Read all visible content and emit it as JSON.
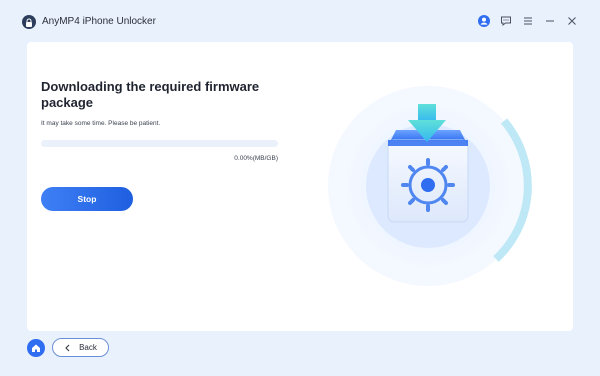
{
  "window": {
    "title": "AnyMP4 iPhone Unlocker",
    "controls": [
      "user-icon",
      "feedback-icon",
      "menu-icon",
      "minimize-icon",
      "close-icon"
    ]
  },
  "main": {
    "heading": "Downloading the required firmware package",
    "subtext": "It may take some time. Please be patient.",
    "progress_percent": 0,
    "progress_text": "0.00%(MB/GB)",
    "stop_label": "Stop"
  },
  "footer": {
    "back_label": "Back"
  },
  "colors": {
    "accent": "#2f6ef0",
    "background": "#e9f1fc",
    "card": "#ffffff"
  }
}
